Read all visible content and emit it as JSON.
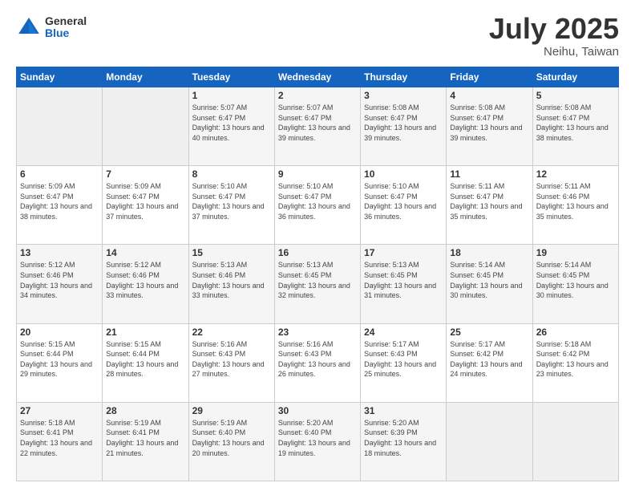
{
  "header": {
    "logo_general": "General",
    "logo_blue": "Blue",
    "title": "July 2025",
    "location": "Neihu, Taiwan"
  },
  "weekdays": [
    "Sunday",
    "Monday",
    "Tuesday",
    "Wednesday",
    "Thursday",
    "Friday",
    "Saturday"
  ],
  "weeks": [
    [
      {
        "day": "",
        "info": ""
      },
      {
        "day": "",
        "info": ""
      },
      {
        "day": "1",
        "info": "Sunrise: 5:07 AM\nSunset: 6:47 PM\nDaylight: 13 hours and 40 minutes."
      },
      {
        "day": "2",
        "info": "Sunrise: 5:07 AM\nSunset: 6:47 PM\nDaylight: 13 hours and 39 minutes."
      },
      {
        "day": "3",
        "info": "Sunrise: 5:08 AM\nSunset: 6:47 PM\nDaylight: 13 hours and 39 minutes."
      },
      {
        "day": "4",
        "info": "Sunrise: 5:08 AM\nSunset: 6:47 PM\nDaylight: 13 hours and 39 minutes."
      },
      {
        "day": "5",
        "info": "Sunrise: 5:08 AM\nSunset: 6:47 PM\nDaylight: 13 hours and 38 minutes."
      }
    ],
    [
      {
        "day": "6",
        "info": "Sunrise: 5:09 AM\nSunset: 6:47 PM\nDaylight: 13 hours and 38 minutes."
      },
      {
        "day": "7",
        "info": "Sunrise: 5:09 AM\nSunset: 6:47 PM\nDaylight: 13 hours and 37 minutes."
      },
      {
        "day": "8",
        "info": "Sunrise: 5:10 AM\nSunset: 6:47 PM\nDaylight: 13 hours and 37 minutes."
      },
      {
        "day": "9",
        "info": "Sunrise: 5:10 AM\nSunset: 6:47 PM\nDaylight: 13 hours and 36 minutes."
      },
      {
        "day": "10",
        "info": "Sunrise: 5:10 AM\nSunset: 6:47 PM\nDaylight: 13 hours and 36 minutes."
      },
      {
        "day": "11",
        "info": "Sunrise: 5:11 AM\nSunset: 6:47 PM\nDaylight: 13 hours and 35 minutes."
      },
      {
        "day": "12",
        "info": "Sunrise: 5:11 AM\nSunset: 6:46 PM\nDaylight: 13 hours and 35 minutes."
      }
    ],
    [
      {
        "day": "13",
        "info": "Sunrise: 5:12 AM\nSunset: 6:46 PM\nDaylight: 13 hours and 34 minutes."
      },
      {
        "day": "14",
        "info": "Sunrise: 5:12 AM\nSunset: 6:46 PM\nDaylight: 13 hours and 33 minutes."
      },
      {
        "day": "15",
        "info": "Sunrise: 5:13 AM\nSunset: 6:46 PM\nDaylight: 13 hours and 33 minutes."
      },
      {
        "day": "16",
        "info": "Sunrise: 5:13 AM\nSunset: 6:45 PM\nDaylight: 13 hours and 32 minutes."
      },
      {
        "day": "17",
        "info": "Sunrise: 5:13 AM\nSunset: 6:45 PM\nDaylight: 13 hours and 31 minutes."
      },
      {
        "day": "18",
        "info": "Sunrise: 5:14 AM\nSunset: 6:45 PM\nDaylight: 13 hours and 30 minutes."
      },
      {
        "day": "19",
        "info": "Sunrise: 5:14 AM\nSunset: 6:45 PM\nDaylight: 13 hours and 30 minutes."
      }
    ],
    [
      {
        "day": "20",
        "info": "Sunrise: 5:15 AM\nSunset: 6:44 PM\nDaylight: 13 hours and 29 minutes."
      },
      {
        "day": "21",
        "info": "Sunrise: 5:15 AM\nSunset: 6:44 PM\nDaylight: 13 hours and 28 minutes."
      },
      {
        "day": "22",
        "info": "Sunrise: 5:16 AM\nSunset: 6:43 PM\nDaylight: 13 hours and 27 minutes."
      },
      {
        "day": "23",
        "info": "Sunrise: 5:16 AM\nSunset: 6:43 PM\nDaylight: 13 hours and 26 minutes."
      },
      {
        "day": "24",
        "info": "Sunrise: 5:17 AM\nSunset: 6:43 PM\nDaylight: 13 hours and 25 minutes."
      },
      {
        "day": "25",
        "info": "Sunrise: 5:17 AM\nSunset: 6:42 PM\nDaylight: 13 hours and 24 minutes."
      },
      {
        "day": "26",
        "info": "Sunrise: 5:18 AM\nSunset: 6:42 PM\nDaylight: 13 hours and 23 minutes."
      }
    ],
    [
      {
        "day": "27",
        "info": "Sunrise: 5:18 AM\nSunset: 6:41 PM\nDaylight: 13 hours and 22 minutes."
      },
      {
        "day": "28",
        "info": "Sunrise: 5:19 AM\nSunset: 6:41 PM\nDaylight: 13 hours and 21 minutes."
      },
      {
        "day": "29",
        "info": "Sunrise: 5:19 AM\nSunset: 6:40 PM\nDaylight: 13 hours and 20 minutes."
      },
      {
        "day": "30",
        "info": "Sunrise: 5:20 AM\nSunset: 6:40 PM\nDaylight: 13 hours and 19 minutes."
      },
      {
        "day": "31",
        "info": "Sunrise: 5:20 AM\nSunset: 6:39 PM\nDaylight: 13 hours and 18 minutes."
      },
      {
        "day": "",
        "info": ""
      },
      {
        "day": "",
        "info": ""
      }
    ]
  ]
}
